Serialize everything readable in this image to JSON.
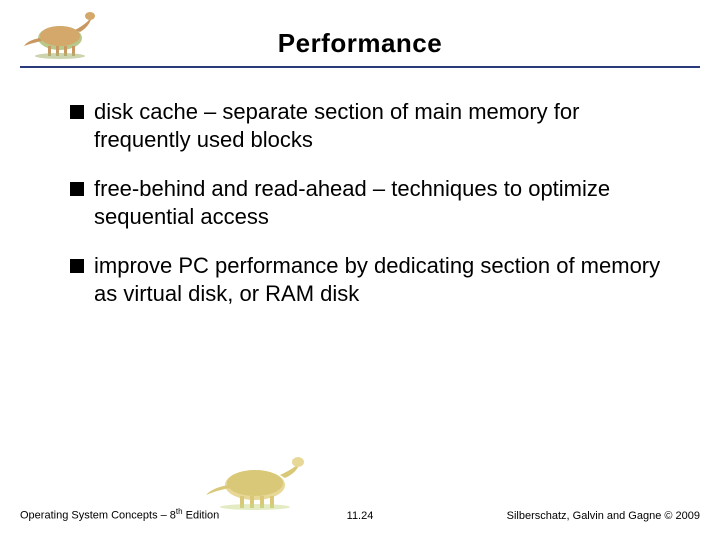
{
  "title": "Performance",
  "bullets": [
    "disk cache – separate section of main memory for frequently used blocks",
    "free-behind and read-ahead – techniques to optimize sequential access",
    "improve PC performance by dedicating section of memory as virtual disk, or RAM disk"
  ],
  "footer": {
    "left_prefix": "Operating System Concepts – 8",
    "left_sup": "th",
    "left_suffix": " Edition",
    "center": "11.24",
    "right": "Silberschatz, Galvin and Gagne © 2009"
  }
}
